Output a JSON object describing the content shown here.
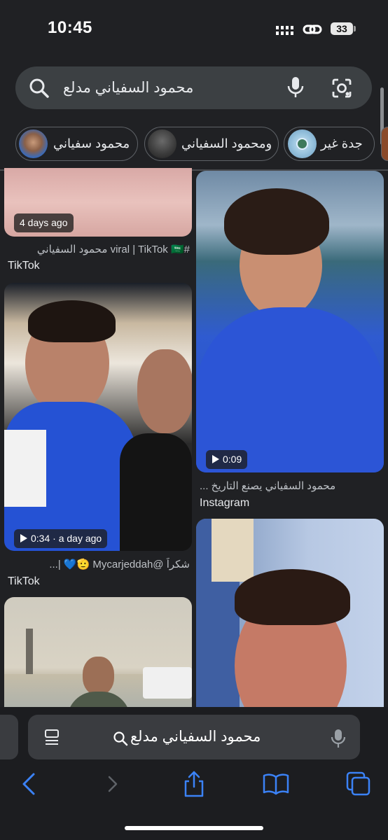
{
  "status_bar": {
    "time": "10:45",
    "battery": "33"
  },
  "search": {
    "query": "محمود السفياني مدلع"
  },
  "chips": [
    {
      "label": "جدة غير"
    },
    {
      "label": "ومحمود السفياني"
    },
    {
      "label": "محمود سفياني"
    }
  ],
  "results": [
    {
      "badge": "4 days ago",
      "caption": "#viral | TikTok 🇸🇦 محمود السفياني",
      "source": "TikTok"
    },
    {
      "badge": "0:09",
      "caption": "محمود السفياني يصنع التاريخ ...",
      "source": "Instagram"
    },
    {
      "badge": "0:34 · a day ago",
      "caption": "شكراً @Mycarjeddah 🫡💙 |...",
      "source": "TikTok"
    }
  ],
  "address_bar": {
    "text": "محمود السفياني مدلع"
  }
}
